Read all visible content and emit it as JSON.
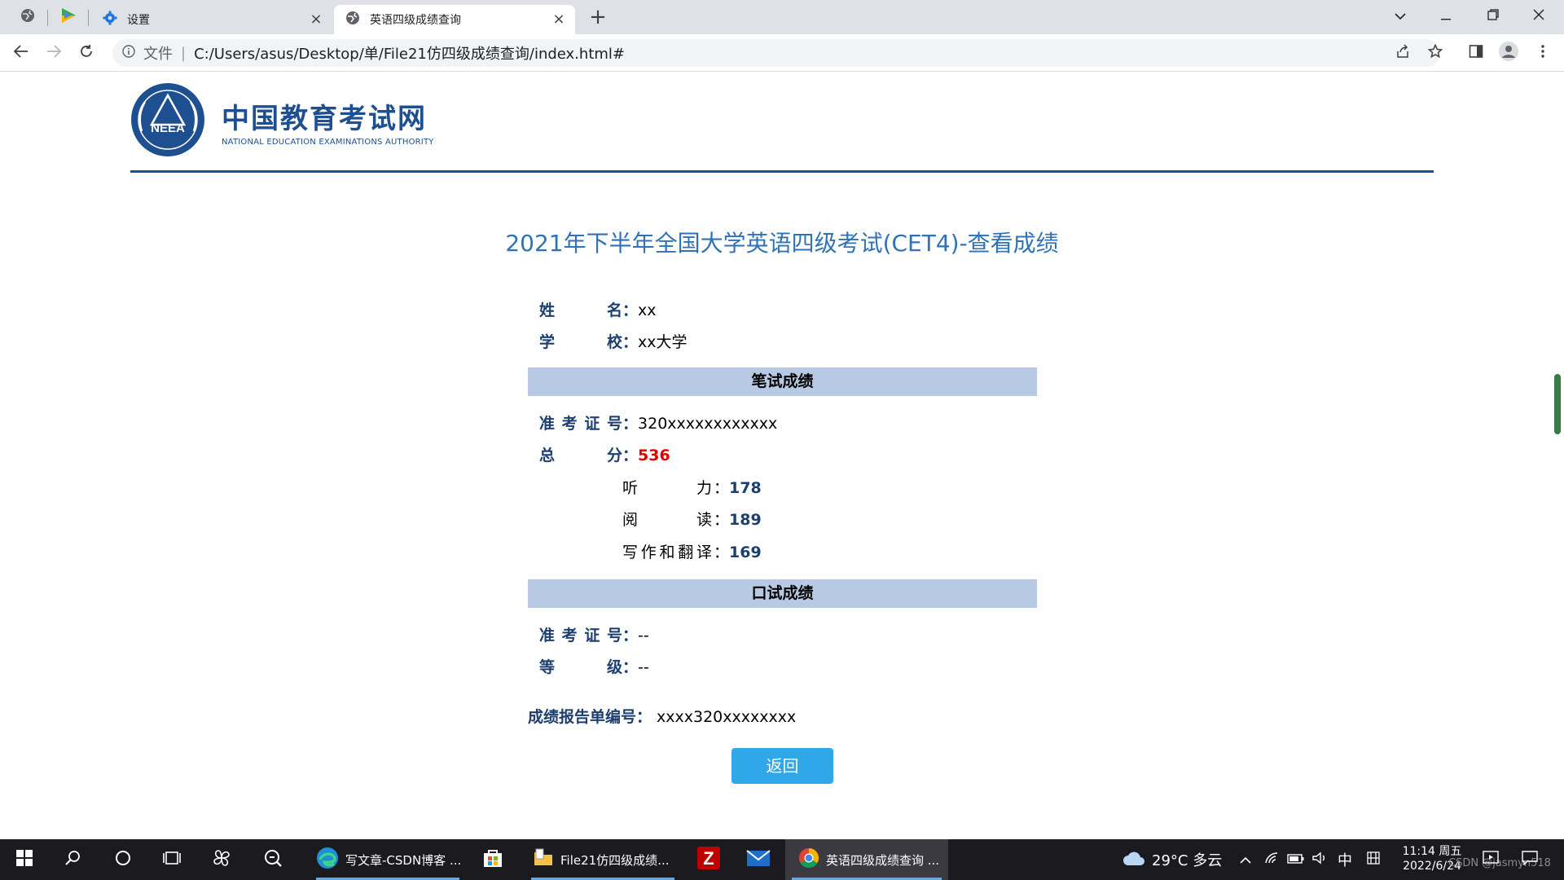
{
  "browser": {
    "tabs": [
      {
        "title": "设置"
      },
      {
        "title": "英语四级成绩查询"
      }
    ],
    "address": {
      "protocol_label": "文件",
      "url": "C:/Users/asus/Desktop/单/File21仿四级成绩查询/index.html#"
    }
  },
  "header": {
    "logo_badge": "NEEA",
    "logo_cn": "中国教育考试网",
    "logo_en": "NATIONAL EDUCATION EXAMINATIONS AUTHORITY"
  },
  "exam_title": "2021年下半年全国大学英语四级考试(CET4)-查看成绩",
  "personal": {
    "name_label": "姓名",
    "name_value": "xx",
    "school_label": "学校",
    "school_value": "xx大学"
  },
  "written": {
    "section_title": "笔试成绩",
    "ticket_label": "准考证号",
    "ticket_value": "320xxxxxxxxxxxx",
    "total_label": "总分",
    "total_value": "536",
    "listening_label": "听力",
    "listening_value": "178",
    "reading_label": "阅读",
    "reading_value": "189",
    "writing_label": "写作和翻译",
    "writing_value": "169"
  },
  "oral": {
    "section_title": "口试成绩",
    "ticket_label": "准考证号",
    "ticket_value": "--",
    "grade_label": "等级",
    "grade_value": "--"
  },
  "report": {
    "label": "成绩报告单编号",
    "value": "xxxx320xxxxxxxx"
  },
  "colon": "：",
  "back_button": "返回",
  "taskbar": {
    "apps": [
      {
        "label": "写文章-CSDN博客 ..."
      },
      {
        "label": "File21仿四级成绩..."
      },
      {
        "label": "英语四级成绩查询 ..."
      }
    ],
    "weather": "29°C 多云",
    "ime": "中",
    "time": "11:14 周五",
    "date": "2022/6/24",
    "watermark": "CSDN @jasmyn518"
  },
  "colors": {
    "brand_blue": "#1d4f91",
    "title_blue": "#2f72b6",
    "section_bg": "#b8c9e3",
    "score_red": "#e00000",
    "button_blue": "#2fa7e8"
  },
  "icons": [
    "settings-icon",
    "globe-icon",
    "back-arrow-icon",
    "forward-arrow-icon",
    "reload-icon",
    "info-icon",
    "share-icon",
    "star-icon",
    "sidepanel-icon",
    "profile-icon",
    "more-icon",
    "windows-start-icon",
    "search-icon",
    "cortana-icon",
    "taskview-icon",
    "edge-icon",
    "store-icon",
    "explorer-icon",
    "filezilla-icon",
    "mail-icon",
    "chrome-icon",
    "weather-icon",
    "wifi-icon",
    "battery-icon",
    "volume-icon",
    "notification-icon"
  ]
}
